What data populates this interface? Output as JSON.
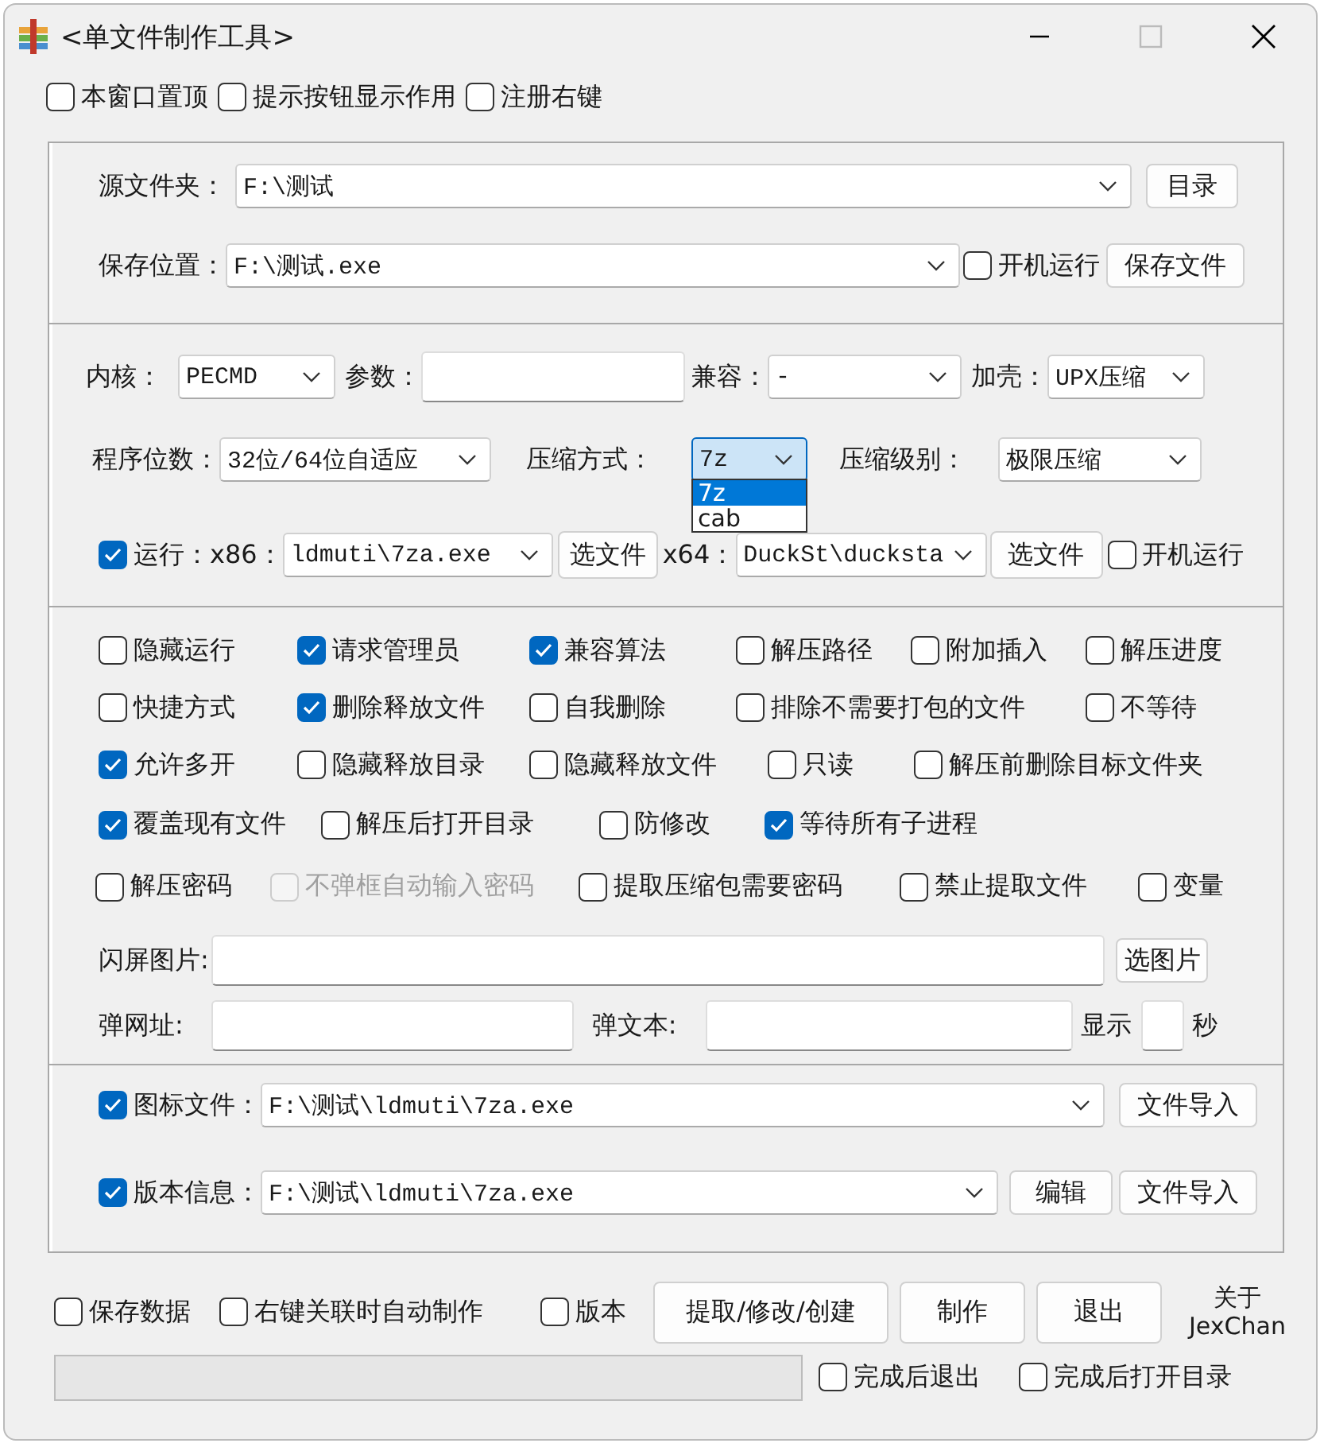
{
  "window": {
    "title": "<单文件制作工具>"
  },
  "top_options": [
    {
      "label": "本窗口置顶",
      "checked": false
    },
    {
      "label": "提示按钮显示作用",
      "checked": false
    },
    {
      "label": "注册右键",
      "checked": false
    }
  ],
  "source": {
    "label": "源文件夹：",
    "value": "F:\\测试",
    "button": "目录"
  },
  "save": {
    "label": "保存位置：",
    "value": "F:\\测试.exe",
    "autostart": {
      "label": "开机运行",
      "checked": false
    },
    "button": "保存文件"
  },
  "core": {
    "label": "内核：",
    "value": "PECMD"
  },
  "params": {
    "label": "参数："
  },
  "compat": {
    "label": "兼容：",
    "value": "-"
  },
  "shell": {
    "label": "加壳：",
    "value": "UPX压缩"
  },
  "bits": {
    "label": "程序位数：",
    "value": "32位/64位自适应"
  },
  "compress_method": {
    "label": "压缩方式：",
    "value": "7z",
    "expanded": true,
    "options": [
      {
        "label": "7z",
        "selected": true
      },
      {
        "label": "cab",
        "selected": false
      }
    ]
  },
  "compress_level": {
    "label": "压缩级别：",
    "value": "极限压缩"
  },
  "run": {
    "checked": true,
    "label": "运行：",
    "x86_label": "x86：",
    "x86_value": "ldmuti\\7za.exe",
    "x86_button": "选文件",
    "x64_label": "x64：",
    "x64_value": "DuckSt\\ducksta",
    "x64_button": "选文件",
    "autostart": {
      "label": "开机运行",
      "checked": false
    }
  },
  "options": [
    [
      {
        "label": "隐藏运行",
        "checked": false,
        "disabled": false
      },
      {
        "label": "请求管理员",
        "checked": true,
        "disabled": false
      },
      {
        "label": "兼容算法",
        "checked": true,
        "disabled": false
      },
      {
        "label": "解压路径",
        "checked": false,
        "disabled": false
      },
      {
        "label": "附加插入",
        "checked": false,
        "disabled": false
      },
      {
        "label": "解压进度",
        "checked": false,
        "disabled": false
      }
    ],
    [
      {
        "label": "快捷方式",
        "checked": false,
        "disabled": false
      },
      {
        "label": "删除释放文件",
        "checked": true,
        "disabled": false
      },
      {
        "label": "自我删除",
        "checked": false,
        "disabled": false
      },
      {
        "label": "排除不需要打包的文件",
        "checked": false,
        "disabled": false
      },
      {
        "label": "不等待",
        "checked": false,
        "disabled": false
      }
    ],
    [
      {
        "label": "允许多开",
        "checked": true,
        "disabled": false
      },
      {
        "label": "隐藏释放目录",
        "checked": false,
        "disabled": false
      },
      {
        "label": "隐藏释放文件",
        "checked": false,
        "disabled": false
      },
      {
        "label": "只读",
        "checked": false,
        "disabled": false
      },
      {
        "label": "解压前删除目标文件夹",
        "checked": false,
        "disabled": false
      }
    ],
    [
      {
        "label": "覆盖现有文件",
        "checked": true,
        "disabled": false
      },
      {
        "label": "解压后打开目录",
        "checked": false,
        "disabled": false
      },
      {
        "label": "防修改",
        "checked": false,
        "disabled": false
      },
      {
        "label": "等待所有子进程",
        "checked": true,
        "disabled": false
      }
    ],
    [
      {
        "label": "解压密码",
        "checked": false,
        "disabled": false
      },
      {
        "label": "不弹框自动输入密码",
        "checked": false,
        "disabled": true
      },
      {
        "label": "提取压缩包需要密码",
        "checked": false,
        "disabled": false
      },
      {
        "label": "禁止提取文件",
        "checked": false,
        "disabled": false
      },
      {
        "label": "变量",
        "checked": false,
        "disabled": false
      }
    ]
  ],
  "splash": {
    "label": "闪屏图片:",
    "button": "选图片"
  },
  "popup": {
    "url_label": "弹网址:",
    "text_label": "弹文本:",
    "show_label": "显示",
    "seconds_label": "秒"
  },
  "icon_file": {
    "checked": true,
    "label": "图标文件：",
    "value": "F:\\测试\\ldmuti\\7za.exe",
    "button": "文件导入"
  },
  "version_info": {
    "checked": true,
    "label": "版本信息：",
    "value": "F:\\测试\\ldmuti\\7za.exe",
    "buttons": [
      "编辑",
      "文件导入"
    ]
  },
  "bottom_options": [
    {
      "label": "保存数据",
      "checked": false
    },
    {
      "label": "右键关联时自动制作",
      "checked": false
    },
    {
      "label": "版本",
      "checked": false
    }
  ],
  "buttons": [
    "提取/修改/创建",
    "制作",
    "退出"
  ],
  "about": {
    "title": "关于",
    "author": "JexChan"
  },
  "progress": {
    "level": 0
  },
  "finish_options": [
    {
      "label": "完成后退出",
      "checked": false
    },
    {
      "label": "完成后打开目录",
      "checked": false
    }
  ]
}
